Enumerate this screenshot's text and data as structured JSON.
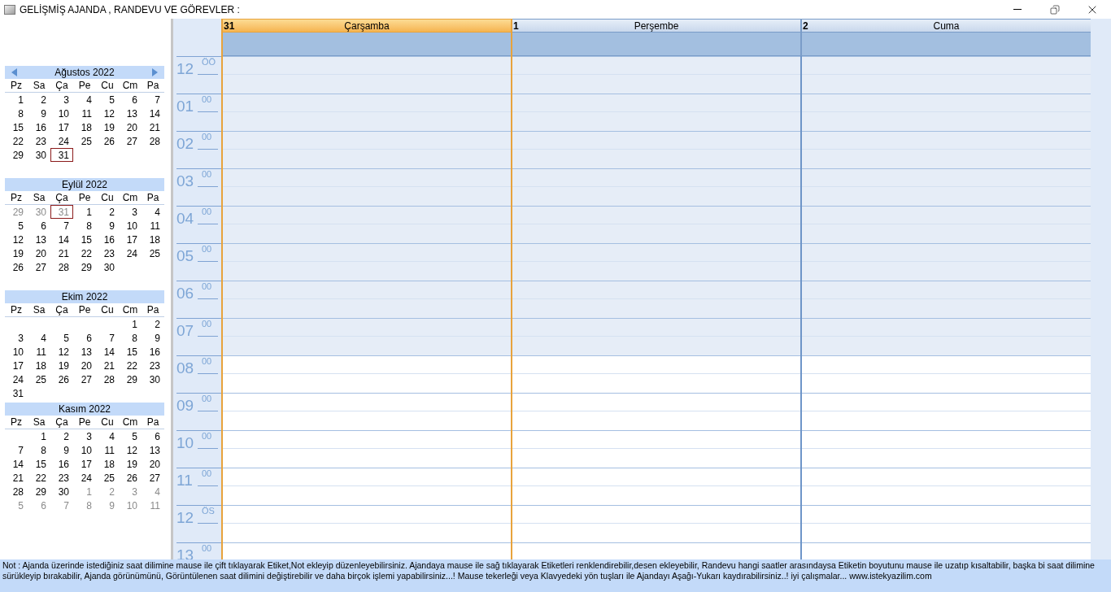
{
  "window": {
    "title": "GELİŞMİŞ AJANDA , RANDEVU VE GÖREVLER :"
  },
  "months": [
    {
      "title": "Ağustos 2022",
      "navigation": true,
      "weekdays": [
        "Pz",
        "Sa",
        "Ça",
        "Pe",
        "Cu",
        "Cm",
        "Pa"
      ],
      "weeks": [
        [
          {
            "kind": "day",
            "day": "1",
            "other_month": false,
            "selected": false
          },
          {
            "kind": "day",
            "day": "2",
            "other_month": false,
            "selected": false
          },
          {
            "kind": "day",
            "day": "3",
            "other_month": false,
            "selected": false
          },
          {
            "kind": "day",
            "day": "4",
            "other_month": false,
            "selected": false
          },
          {
            "kind": "day",
            "day": "5",
            "other_month": false,
            "selected": false
          },
          {
            "kind": "day",
            "day": "6",
            "other_month": false,
            "selected": false
          },
          {
            "kind": "day",
            "day": "7",
            "other_month": false,
            "selected": false
          }
        ],
        [
          {
            "kind": "day",
            "day": "8",
            "other_month": false,
            "selected": false
          },
          {
            "kind": "day",
            "day": "9",
            "other_month": false,
            "selected": false
          },
          {
            "kind": "day",
            "day": "10",
            "other_month": false,
            "selected": false
          },
          {
            "kind": "day",
            "day": "11",
            "other_month": false,
            "selected": false
          },
          {
            "kind": "day",
            "day": "12",
            "other_month": false,
            "selected": false
          },
          {
            "kind": "day",
            "day": "13",
            "other_month": false,
            "selected": false
          },
          {
            "kind": "day",
            "day": "14",
            "other_month": false,
            "selected": false
          }
        ],
        [
          {
            "kind": "day",
            "day": "15",
            "other_month": false,
            "selected": false
          },
          {
            "kind": "day",
            "day": "16",
            "other_month": false,
            "selected": false
          },
          {
            "kind": "day",
            "day": "17",
            "other_month": false,
            "selected": false
          },
          {
            "kind": "day",
            "day": "18",
            "other_month": false,
            "selected": false
          },
          {
            "kind": "day",
            "day": "19",
            "other_month": false,
            "selected": false
          },
          {
            "kind": "day",
            "day": "20",
            "other_month": false,
            "selected": false
          },
          {
            "kind": "day",
            "day": "21",
            "other_month": false,
            "selected": false
          }
        ],
        [
          {
            "kind": "day",
            "day": "22",
            "other_month": false,
            "selected": false
          },
          {
            "kind": "day",
            "day": "23",
            "other_month": false,
            "selected": false
          },
          {
            "kind": "day",
            "day": "24",
            "other_month": false,
            "selected": false
          },
          {
            "kind": "day",
            "day": "25",
            "other_month": false,
            "selected": false
          },
          {
            "kind": "day",
            "day": "26",
            "other_month": false,
            "selected": false
          },
          {
            "kind": "day",
            "day": "27",
            "other_month": false,
            "selected": false
          },
          {
            "kind": "day",
            "day": "28",
            "other_month": false,
            "selected": false
          }
        ],
        [
          {
            "kind": "day",
            "day": "29",
            "other_month": false,
            "selected": false
          },
          {
            "kind": "day",
            "day": "30",
            "other_month": false,
            "selected": false
          },
          {
            "kind": "day",
            "day": "31",
            "other_month": false,
            "selected": true
          },
          {
            "kind": "blank"
          },
          {
            "kind": "blank"
          },
          {
            "kind": "blank"
          },
          {
            "kind": "blank"
          }
        ]
      ]
    },
    {
      "title": "Eylül 2022",
      "navigation": false,
      "weekdays": [
        "Pz",
        "Sa",
        "Ça",
        "Pe",
        "Cu",
        "Cm",
        "Pa"
      ],
      "weeks": [
        [
          {
            "kind": "day",
            "day": "29",
            "other_month": true,
            "selected": false
          },
          {
            "kind": "day",
            "day": "30",
            "other_month": true,
            "selected": false
          },
          {
            "kind": "day",
            "day": "31",
            "other_month": true,
            "selected": true
          },
          {
            "kind": "day",
            "day": "1",
            "other_month": false,
            "selected": false
          },
          {
            "kind": "day",
            "day": "2",
            "other_month": false,
            "selected": false
          },
          {
            "kind": "day",
            "day": "3",
            "other_month": false,
            "selected": false
          },
          {
            "kind": "day",
            "day": "4",
            "other_month": false,
            "selected": false
          }
        ],
        [
          {
            "kind": "day",
            "day": "5",
            "other_month": false,
            "selected": false
          },
          {
            "kind": "day",
            "day": "6",
            "other_month": false,
            "selected": false
          },
          {
            "kind": "day",
            "day": "7",
            "other_month": false,
            "selected": false
          },
          {
            "kind": "day",
            "day": "8",
            "other_month": false,
            "selected": false
          },
          {
            "kind": "day",
            "day": "9",
            "other_month": false,
            "selected": false
          },
          {
            "kind": "day",
            "day": "10",
            "other_month": false,
            "selected": false
          },
          {
            "kind": "day",
            "day": "11",
            "other_month": false,
            "selected": false
          }
        ],
        [
          {
            "kind": "day",
            "day": "12",
            "other_month": false,
            "selected": false
          },
          {
            "kind": "day",
            "day": "13",
            "other_month": false,
            "selected": false
          },
          {
            "kind": "day",
            "day": "14",
            "other_month": false,
            "selected": false
          },
          {
            "kind": "day",
            "day": "15",
            "other_month": false,
            "selected": false
          },
          {
            "kind": "day",
            "day": "16",
            "other_month": false,
            "selected": false
          },
          {
            "kind": "day",
            "day": "17",
            "other_month": false,
            "selected": false
          },
          {
            "kind": "day",
            "day": "18",
            "other_month": false,
            "selected": false
          }
        ],
        [
          {
            "kind": "day",
            "day": "19",
            "other_month": false,
            "selected": false
          },
          {
            "kind": "day",
            "day": "20",
            "other_month": false,
            "selected": false
          },
          {
            "kind": "day",
            "day": "21",
            "other_month": false,
            "selected": false
          },
          {
            "kind": "day",
            "day": "22",
            "other_month": false,
            "selected": false
          },
          {
            "kind": "day",
            "day": "23",
            "other_month": false,
            "selected": false
          },
          {
            "kind": "day",
            "day": "24",
            "other_month": false,
            "selected": false
          },
          {
            "kind": "day",
            "day": "25",
            "other_month": false,
            "selected": false
          }
        ],
        [
          {
            "kind": "day",
            "day": "26",
            "other_month": false,
            "selected": false
          },
          {
            "kind": "day",
            "day": "27",
            "other_month": false,
            "selected": false
          },
          {
            "kind": "day",
            "day": "28",
            "other_month": false,
            "selected": false
          },
          {
            "kind": "day",
            "day": "29",
            "other_month": false,
            "selected": false
          },
          {
            "kind": "day",
            "day": "30",
            "other_month": false,
            "selected": false
          },
          {
            "kind": "blank"
          },
          {
            "kind": "blank"
          }
        ]
      ]
    },
    {
      "title": "Ekim 2022",
      "navigation": false,
      "weekdays": [
        "Pz",
        "Sa",
        "Ça",
        "Pe",
        "Cu",
        "Cm",
        "Pa"
      ],
      "weeks": [
        [
          {
            "kind": "blank"
          },
          {
            "kind": "blank"
          },
          {
            "kind": "blank"
          },
          {
            "kind": "blank"
          },
          {
            "kind": "blank"
          },
          {
            "kind": "day",
            "day": "1",
            "other_month": false,
            "selected": false
          },
          {
            "kind": "day",
            "day": "2",
            "other_month": false,
            "selected": false
          }
        ],
        [
          {
            "kind": "day",
            "day": "3",
            "other_month": false,
            "selected": false
          },
          {
            "kind": "day",
            "day": "4",
            "other_month": false,
            "selected": false
          },
          {
            "kind": "day",
            "day": "5",
            "other_month": false,
            "selected": false
          },
          {
            "kind": "day",
            "day": "6",
            "other_month": false,
            "selected": false
          },
          {
            "kind": "day",
            "day": "7",
            "other_month": false,
            "selected": false
          },
          {
            "kind": "day",
            "day": "8",
            "other_month": false,
            "selected": false
          },
          {
            "kind": "day",
            "day": "9",
            "other_month": false,
            "selected": false
          }
        ],
        [
          {
            "kind": "day",
            "day": "10",
            "other_month": false,
            "selected": false
          },
          {
            "kind": "day",
            "day": "11",
            "other_month": false,
            "selected": false
          },
          {
            "kind": "day",
            "day": "12",
            "other_month": false,
            "selected": false
          },
          {
            "kind": "day",
            "day": "13",
            "other_month": false,
            "selected": false
          },
          {
            "kind": "day",
            "day": "14",
            "other_month": false,
            "selected": false
          },
          {
            "kind": "day",
            "day": "15",
            "other_month": false,
            "selected": false
          },
          {
            "kind": "day",
            "day": "16",
            "other_month": false,
            "selected": false
          }
        ],
        [
          {
            "kind": "day",
            "day": "17",
            "other_month": false,
            "selected": false
          },
          {
            "kind": "day",
            "day": "18",
            "other_month": false,
            "selected": false
          },
          {
            "kind": "day",
            "day": "19",
            "other_month": false,
            "selected": false
          },
          {
            "kind": "day",
            "day": "20",
            "other_month": false,
            "selected": false
          },
          {
            "kind": "day",
            "day": "21",
            "other_month": false,
            "selected": false
          },
          {
            "kind": "day",
            "day": "22",
            "other_month": false,
            "selected": false
          },
          {
            "kind": "day",
            "day": "23",
            "other_month": false,
            "selected": false
          }
        ],
        [
          {
            "kind": "day",
            "day": "24",
            "other_month": false,
            "selected": false
          },
          {
            "kind": "day",
            "day": "25",
            "other_month": false,
            "selected": false
          },
          {
            "kind": "day",
            "day": "26",
            "other_month": false,
            "selected": false
          },
          {
            "kind": "day",
            "day": "27",
            "other_month": false,
            "selected": false
          },
          {
            "kind": "day",
            "day": "28",
            "other_month": false,
            "selected": false
          },
          {
            "kind": "day",
            "day": "29",
            "other_month": false,
            "selected": false
          },
          {
            "kind": "day",
            "day": "30",
            "other_month": false,
            "selected": false
          }
        ],
        [
          {
            "kind": "day",
            "day": "31",
            "other_month": false,
            "selected": false
          },
          {
            "kind": "blank"
          },
          {
            "kind": "blank"
          },
          {
            "kind": "blank"
          },
          {
            "kind": "blank"
          },
          {
            "kind": "blank"
          },
          {
            "kind": "blank"
          }
        ]
      ]
    },
    {
      "title": "Kasım 2022",
      "navigation": false,
      "weekdays": [
        "Pz",
        "Sa",
        "Ça",
        "Pe",
        "Cu",
        "Cm",
        "Pa"
      ],
      "weeks": [
        [
          {
            "kind": "blank"
          },
          {
            "kind": "day",
            "day": "1",
            "other_month": false,
            "selected": false
          },
          {
            "kind": "day",
            "day": "2",
            "other_month": false,
            "selected": false
          },
          {
            "kind": "day",
            "day": "3",
            "other_month": false,
            "selected": false
          },
          {
            "kind": "day",
            "day": "4",
            "other_month": false,
            "selected": false
          },
          {
            "kind": "day",
            "day": "5",
            "other_month": false,
            "selected": false
          },
          {
            "kind": "day",
            "day": "6",
            "other_month": false,
            "selected": false
          }
        ],
        [
          {
            "kind": "day",
            "day": "7",
            "other_month": false,
            "selected": false
          },
          {
            "kind": "day",
            "day": "8",
            "other_month": false,
            "selected": false
          },
          {
            "kind": "day",
            "day": "9",
            "other_month": false,
            "selected": false
          },
          {
            "kind": "day",
            "day": "10",
            "other_month": false,
            "selected": false
          },
          {
            "kind": "day",
            "day": "11",
            "other_month": false,
            "selected": false
          },
          {
            "kind": "day",
            "day": "12",
            "other_month": false,
            "selected": false
          },
          {
            "kind": "day",
            "day": "13",
            "other_month": false,
            "selected": false
          }
        ],
        [
          {
            "kind": "day",
            "day": "14",
            "other_month": false,
            "selected": false
          },
          {
            "kind": "day",
            "day": "15",
            "other_month": false,
            "selected": false
          },
          {
            "kind": "day",
            "day": "16",
            "other_month": false,
            "selected": false
          },
          {
            "kind": "day",
            "day": "17",
            "other_month": false,
            "selected": false
          },
          {
            "kind": "day",
            "day": "18",
            "other_month": false,
            "selected": false
          },
          {
            "kind": "day",
            "day": "19",
            "other_month": false,
            "selected": false
          },
          {
            "kind": "day",
            "day": "20",
            "other_month": false,
            "selected": false
          }
        ],
        [
          {
            "kind": "day",
            "day": "21",
            "other_month": false,
            "selected": false
          },
          {
            "kind": "day",
            "day": "22",
            "other_month": false,
            "selected": false
          },
          {
            "kind": "day",
            "day": "23",
            "other_month": false,
            "selected": false
          },
          {
            "kind": "day",
            "day": "24",
            "other_month": false,
            "selected": false
          },
          {
            "kind": "day",
            "day": "25",
            "other_month": false,
            "selected": false
          },
          {
            "kind": "day",
            "day": "26",
            "other_month": false,
            "selected": false
          },
          {
            "kind": "day",
            "day": "27",
            "other_month": false,
            "selected": false
          }
        ],
        [
          {
            "kind": "day",
            "day": "28",
            "other_month": false,
            "selected": false
          },
          {
            "kind": "day",
            "day": "29",
            "other_month": false,
            "selected": false
          },
          {
            "kind": "day",
            "day": "30",
            "other_month": false,
            "selected": false
          },
          {
            "kind": "day",
            "day": "1",
            "other_month": true,
            "selected": false
          },
          {
            "kind": "day",
            "day": "2",
            "other_month": true,
            "selected": false
          },
          {
            "kind": "day",
            "day": "3",
            "other_month": true,
            "selected": false
          },
          {
            "kind": "day",
            "day": "4",
            "other_month": true,
            "selected": false
          }
        ],
        [
          {
            "kind": "day",
            "day": "5",
            "other_month": true,
            "selected": false
          },
          {
            "kind": "day",
            "day": "6",
            "other_month": true,
            "selected": false
          },
          {
            "kind": "day",
            "day": "7",
            "other_month": true,
            "selected": false
          },
          {
            "kind": "day",
            "day": "8",
            "other_month": true,
            "selected": false
          },
          {
            "kind": "day",
            "day": "9",
            "other_month": true,
            "selected": false
          },
          {
            "kind": "day",
            "day": "10",
            "other_month": true,
            "selected": false
          },
          {
            "kind": "day",
            "day": "11",
            "other_month": true,
            "selected": false
          }
        ]
      ]
    }
  ],
  "days": [
    {
      "number": "31",
      "name": "Çarşamba",
      "selected": true
    },
    {
      "number": "1",
      "name": "Perşembe",
      "selected": false
    },
    {
      "number": "2",
      "name": "Cuma",
      "selected": false
    }
  ],
  "hours": [
    {
      "hour": "12",
      "suffix": "ÖÖ",
      "working": false
    },
    {
      "hour": "01",
      "suffix": "00",
      "working": false
    },
    {
      "hour": "02",
      "suffix": "00",
      "working": false
    },
    {
      "hour": "03",
      "suffix": "00",
      "working": false
    },
    {
      "hour": "04",
      "suffix": "00",
      "working": false
    },
    {
      "hour": "05",
      "suffix": "00",
      "working": false
    },
    {
      "hour": "06",
      "suffix": "00",
      "working": false
    },
    {
      "hour": "07",
      "suffix": "00",
      "working": false
    },
    {
      "hour": "08",
      "suffix": "00",
      "working": true
    },
    {
      "hour": "09",
      "suffix": "00",
      "working": true
    },
    {
      "hour": "10",
      "suffix": "00",
      "working": true
    },
    {
      "hour": "11",
      "suffix": "00",
      "working": true
    },
    {
      "hour": "12",
      "suffix": "ÖS",
      "working": true
    },
    {
      "hour": "13",
      "suffix": "00",
      "working": true
    }
  ],
  "note": "Not : Ajanda üzerinde istediğiniz saat dilimine mause ile çift tıklayarak Etiket,Not ekleyip düzenleyebilirsiniz. Ajandaya mause ile sağ tıklayarak Etiketleri renklendirebilir,desen ekleyebilir, Randevu hangi saatler arasındaysa Etiketin boyutunu mause ile uzatıp kısaltabilir, başka bi saat dilimine sürükleyip bırakabilir, Ajanda görünümünü, Görüntülenen saat dilimini değiştirebilir ve daha birçok işlemi yapabilirsiniz...! Mause tekerleği veya Klavyedeki yön tuşları ile Ajandayı Aşağı-Yukarı kaydırabilirsiniz..!  iyi çalışmalar...   www.istekyazilim.com"
}
